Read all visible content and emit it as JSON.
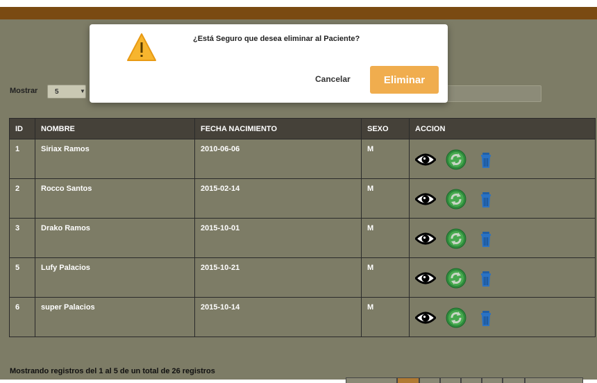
{
  "controls": {
    "show_label": "Mostrar",
    "page_size_value": "5",
    "search_value": ""
  },
  "table": {
    "headers": [
      "ID",
      "NOMBRE",
      "FECHA NACIMIENTO",
      "SEXO",
      "ACCION"
    ],
    "rows": [
      {
        "id": "1",
        "nombre": "Siriax Ramos",
        "fecha": "2010-06-06",
        "sexo": "M"
      },
      {
        "id": "2",
        "nombre": "Rocco Santos",
        "fecha": "2015-02-14",
        "sexo": "M"
      },
      {
        "id": "3",
        "nombre": "Drako Ramos",
        "fecha": "2015-10-01",
        "sexo": "M"
      },
      {
        "id": "5",
        "nombre": "Lufy Palacios",
        "fecha": "2015-10-21",
        "sexo": "M"
      },
      {
        "id": "6",
        "nombre": "super Palacios",
        "fecha": "2015-10-14",
        "sexo": "M"
      }
    ],
    "action_icons": [
      "eye-icon",
      "refresh-icon",
      "trash-icon"
    ]
  },
  "footer": {
    "info": "Mostrando registros del 1 al 5 de un total de 26 registros"
  },
  "modal": {
    "icon": "warning-icon",
    "message": "¿Está Seguro que desea eliminar al Paciente?",
    "cancel_label": "Cancelar",
    "confirm_label": "Eliminar"
  },
  "colors": {
    "header_bar": "#7a4a12",
    "overlay_page": "#7d7c66",
    "table_header": "#454139",
    "confirm_button": "#f0ad4e"
  }
}
